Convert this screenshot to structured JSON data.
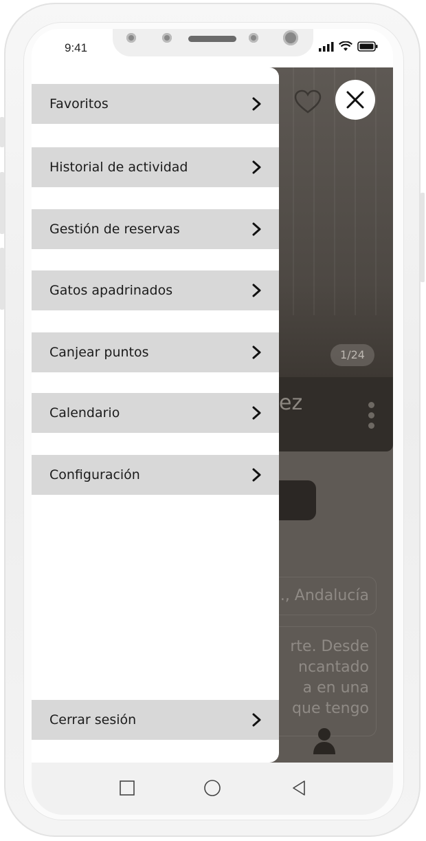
{
  "status_bar": {
    "time": "9:41",
    "icons": [
      "signal-icon",
      "wifi-icon",
      "battery-icon"
    ]
  },
  "background_app": {
    "name_fragment": "ez",
    "photo_counter": "1/24",
    "location_fragment": "., Andalucía",
    "description_lines": [
      "rte. Desde",
      "ncantado",
      "a en una",
      "que tengo"
    ],
    "favorite_icon": "heart-icon",
    "profile_icon": "user-icon"
  },
  "close_button": {
    "icon": "close-icon"
  },
  "menu": {
    "items": [
      {
        "label": "Favoritos"
      },
      {
        "label": "Historial de actividad"
      },
      {
        "label": "Gestión de reservas"
      },
      {
        "label": "Gatos apadrinados"
      },
      {
        "label": "Canjear puntos"
      },
      {
        "label": "Calendario"
      },
      {
        "label": "Configuración"
      }
    ],
    "logout": {
      "label": "Cerrar sesión"
    }
  },
  "nav_bar": {
    "buttons": [
      "recents-icon",
      "home-icon",
      "back-icon"
    ]
  },
  "colors": {
    "menu_item_bg": "#d8d8d8",
    "overlay": "#5f5a55",
    "card_dark": "#312d29"
  }
}
